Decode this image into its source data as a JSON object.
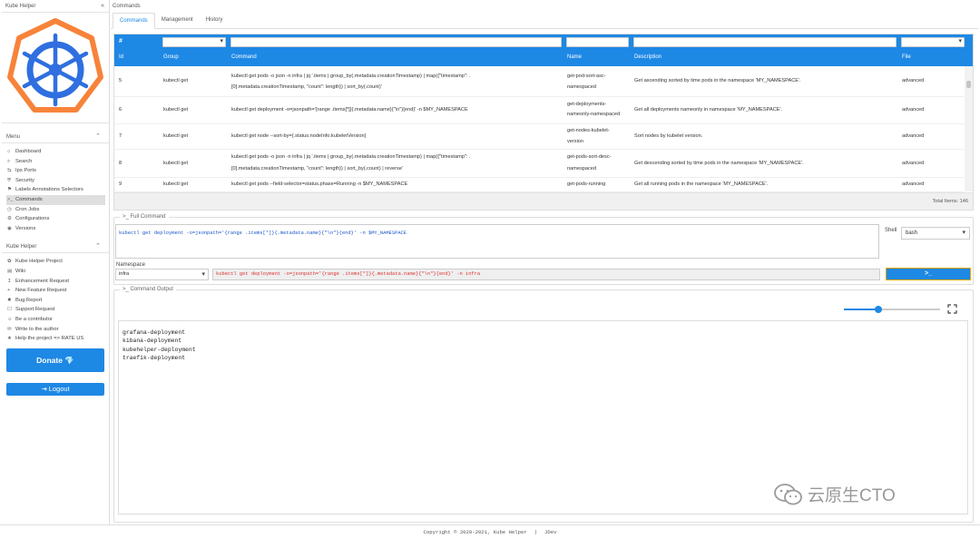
{
  "sidebar": {
    "title": "Kube Helper",
    "collapse_icon": "«",
    "menu_header": "Menu",
    "menu_items": [
      {
        "icon": "⌂",
        "label": "Dashboard"
      },
      {
        "icon": "⌕",
        "label": "Search"
      },
      {
        "icon": "⇆",
        "label": "Ips Ports"
      },
      {
        "icon": "⛨",
        "label": "Security"
      },
      {
        "icon": "⚑",
        "label": "Labels Annotations Selectors"
      },
      {
        "icon": ">_",
        "label": "Commands"
      },
      {
        "icon": "◷",
        "label": "Cron Jobs"
      },
      {
        "icon": "⚙",
        "label": "Configurations"
      },
      {
        "icon": "◉",
        "label": "Versions"
      }
    ],
    "kube_header": "Kube Helper",
    "kube_items": [
      {
        "icon": "✿",
        "label": "Kube Helper Project"
      },
      {
        "icon": "▤",
        "label": "Wiki"
      },
      {
        "icon": "↥",
        "label": "Enhancement Request"
      },
      {
        "icon": "+",
        "label": "New Feature Request"
      },
      {
        "icon": "✸",
        "label": "Bug Report"
      },
      {
        "icon": "☐",
        "label": "Support Request"
      },
      {
        "icon": "☺",
        "label": "Be a contributor"
      },
      {
        "icon": "✉",
        "label": "Write to the author"
      },
      {
        "icon": "★",
        "label": "Help the project => RATE US"
      }
    ],
    "donate_label": "Donate 💎",
    "logout_label": "⇥ Logout"
  },
  "breadcrumb": "Commands",
  "tabs": [
    "Commands",
    "Management",
    "History"
  ],
  "grid": {
    "hash": "#",
    "columns": [
      "Id",
      "Group",
      "Command",
      "Name",
      "Description",
      "File"
    ],
    "rows": [
      {
        "id": "5",
        "group": "kubectl get",
        "command_l1": "kubectl get pods -o json -n infra | jq '.items | group_by(.metadata.creationTimestamp) | map({\"timestamp\": .",
        "command_l2": "[0].metadata.creationTimestamp, \"count\": length}) | sort_by(.count)'",
        "name_l1": "get-pod-sort-asc-",
        "name_l2": "namespaced",
        "description": "Get ascending sorted by time pods in the namespace 'MY_NAMESPACE'.",
        "file": "advanced"
      },
      {
        "id": "6",
        "group": "kubectl get",
        "command_l1": "kubectl get deployment -o=jsonpath='{range .items[*]}{.metadata.name}{\"\\n\"}{end}' -n $MY_NAMESPACE",
        "command_l2": "",
        "name_l1": "get-deployments-",
        "name_l2": "nameonly-namespaced",
        "description": "Get all deployments nameonly in namespace 'MY_NAMESPACE'.",
        "file": "advanced"
      },
      {
        "id": "7",
        "group": "kubectl get",
        "command_l1": "kubectl get node --sort-by={.status.nodeInfo.kubeletVersion}",
        "command_l2": "",
        "name_l1": "get-nodes-kubelet-",
        "name_l2": "version",
        "description": "Sort nodes by kubelet version.",
        "file": "advanced"
      },
      {
        "id": "8",
        "group": "kubectl get",
        "command_l1": "kubectl get pods -o json -n infra | jq '.items | group_by(.metadata.creationTimestamp) | map({\"timestamp\": .",
        "command_l2": "[0].metadata.creationTimestamp, \"count\": length}) | sort_by(.count) | reverse'",
        "name_l1": "get-pods-sort-desc-",
        "name_l2": "namespaced",
        "description": "Get descending sorted by time pods in the namespace 'MY_NAMESPACE'.",
        "file": "advanced"
      },
      {
        "id": "9",
        "group": "kubectl get",
        "command_l1": "kubectl get pods --field-selector=status.phase=Running -n $MY_NAMESPACE",
        "command_l2": "",
        "name_l1": "get-pods-running",
        "name_l2": "",
        "description": "Get all running pods in the namespace 'MY_NAMESPACE'.",
        "file": "advanced"
      }
    ],
    "total_items": "Total Items: 146"
  },
  "full_command": {
    "legend": ">_ Full Command",
    "text": "kubectl get deployment -o=jsonpath='{range .items[*]}{.metadata.name}{\"\\n\"}{end}' -n $MY_NAMESPACE",
    "shell_label": "Shell",
    "shell_value": "bash",
    "namespace_label": "Namespace",
    "namespace_value": "infra",
    "resolved_command": "kubectl get deployment -o=jsonpath='{range .items[*]}{.metadata.name}{\"\\n\"}{end}' -n infra",
    "run_label": ">_"
  },
  "command_output": {
    "legend": ">_ Command Output",
    "font_size_slider": 0.36,
    "lines": [
      "grafana-deployment",
      "kibana-deployment",
      "kubehelper-deployment",
      "traefik-deployment"
    ]
  },
  "watermark": "云原生CTO",
  "footer": {
    "copyright": "Copyright © 2020-2021, Kube Helper",
    "separator": "|",
    "credit": "JDev"
  },
  "colors": {
    "accent": "#1e88e5",
    "logo_orange": "#f7833a",
    "logo_blue": "#2f6fdf"
  }
}
